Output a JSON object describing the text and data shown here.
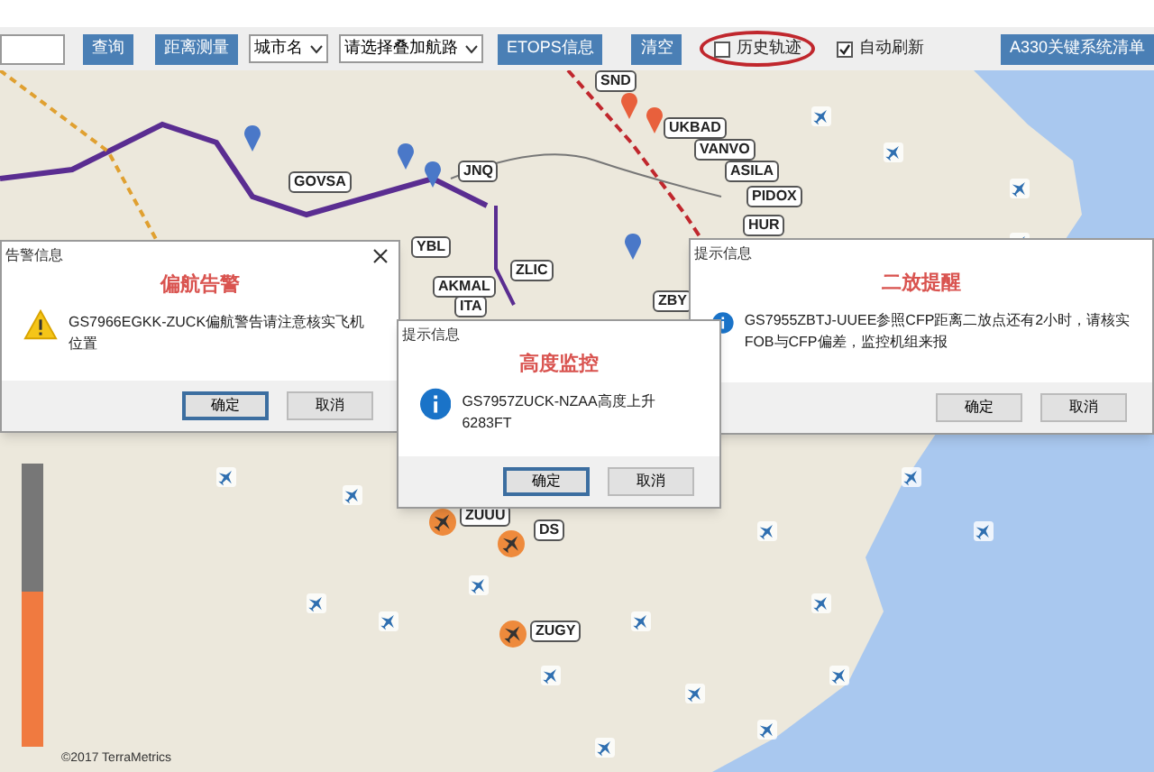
{
  "toolbar": {
    "items": [
      {
        "kind": "field"
      },
      {
        "kind": "button",
        "label": "查询"
      },
      {
        "kind": "button",
        "label": "距离测量"
      },
      {
        "kind": "select",
        "label": "城市名"
      },
      {
        "kind": "select",
        "label": "请选择叠加航路"
      },
      {
        "kind": "button",
        "label": "ETOPS信息"
      },
      {
        "kind": "button",
        "label": "清空"
      },
      {
        "kind": "checkbox",
        "label": "历史轨迹",
        "checked": false,
        "circled": true
      },
      {
        "kind": "checkbox",
        "label": "自动刷新",
        "checked": true,
        "circled": false
      },
      {
        "kind": "button",
        "label": "A330关键系统清单"
      }
    ]
  },
  "map": {
    "waypoints": [
      {
        "label": "SND"
      },
      {
        "label": "UKBAD"
      },
      {
        "label": "VANVO"
      },
      {
        "label": "ASILA"
      },
      {
        "label": "PIDOX"
      },
      {
        "label": "HUR"
      },
      {
        "label": "JNQ"
      },
      {
        "label": "GOVSA"
      },
      {
        "label": "YBL"
      },
      {
        "label": "ZLIC"
      },
      {
        "label": "AKMAL"
      },
      {
        "label": "ITA"
      },
      {
        "label": "ZBY"
      },
      {
        "label": "ZUUU"
      },
      {
        "label": "DS"
      },
      {
        "label": "ZUGY"
      }
    ],
    "gauge": {
      "level": 0.55
    },
    "attribution": "©2017 TerraMetrics"
  },
  "dialogs": [
    {
      "title": "告警信息",
      "heading": "偏航告警",
      "kind": "warning",
      "closable": true,
      "message": "GS7966EGKK-ZUCK偏航警告请注意核实飞机位置",
      "buttons": [
        {
          "label": "确定",
          "default": true
        },
        {
          "label": "取消",
          "default": false
        }
      ]
    },
    {
      "title": "提示信息",
      "heading": "高度监控",
      "kind": "info",
      "closable": false,
      "message": "GS7957ZUCK-NZAA高度上升 6283FT",
      "buttons": [
        {
          "label": "确定",
          "default": true
        },
        {
          "label": "取消",
          "default": false
        }
      ]
    },
    {
      "title": "提示信息",
      "heading": "二放提醒",
      "kind": "info",
      "closable": false,
      "message": "GS7955ZBTJ-UUEE参照CFP距离二放点还有2小时，请核实FOB与CFP偏差，监控机组来报",
      "buttons": [
        {
          "label": "确定",
          "default": false
        },
        {
          "label": "取消",
          "default": false
        }
      ]
    }
  ]
}
